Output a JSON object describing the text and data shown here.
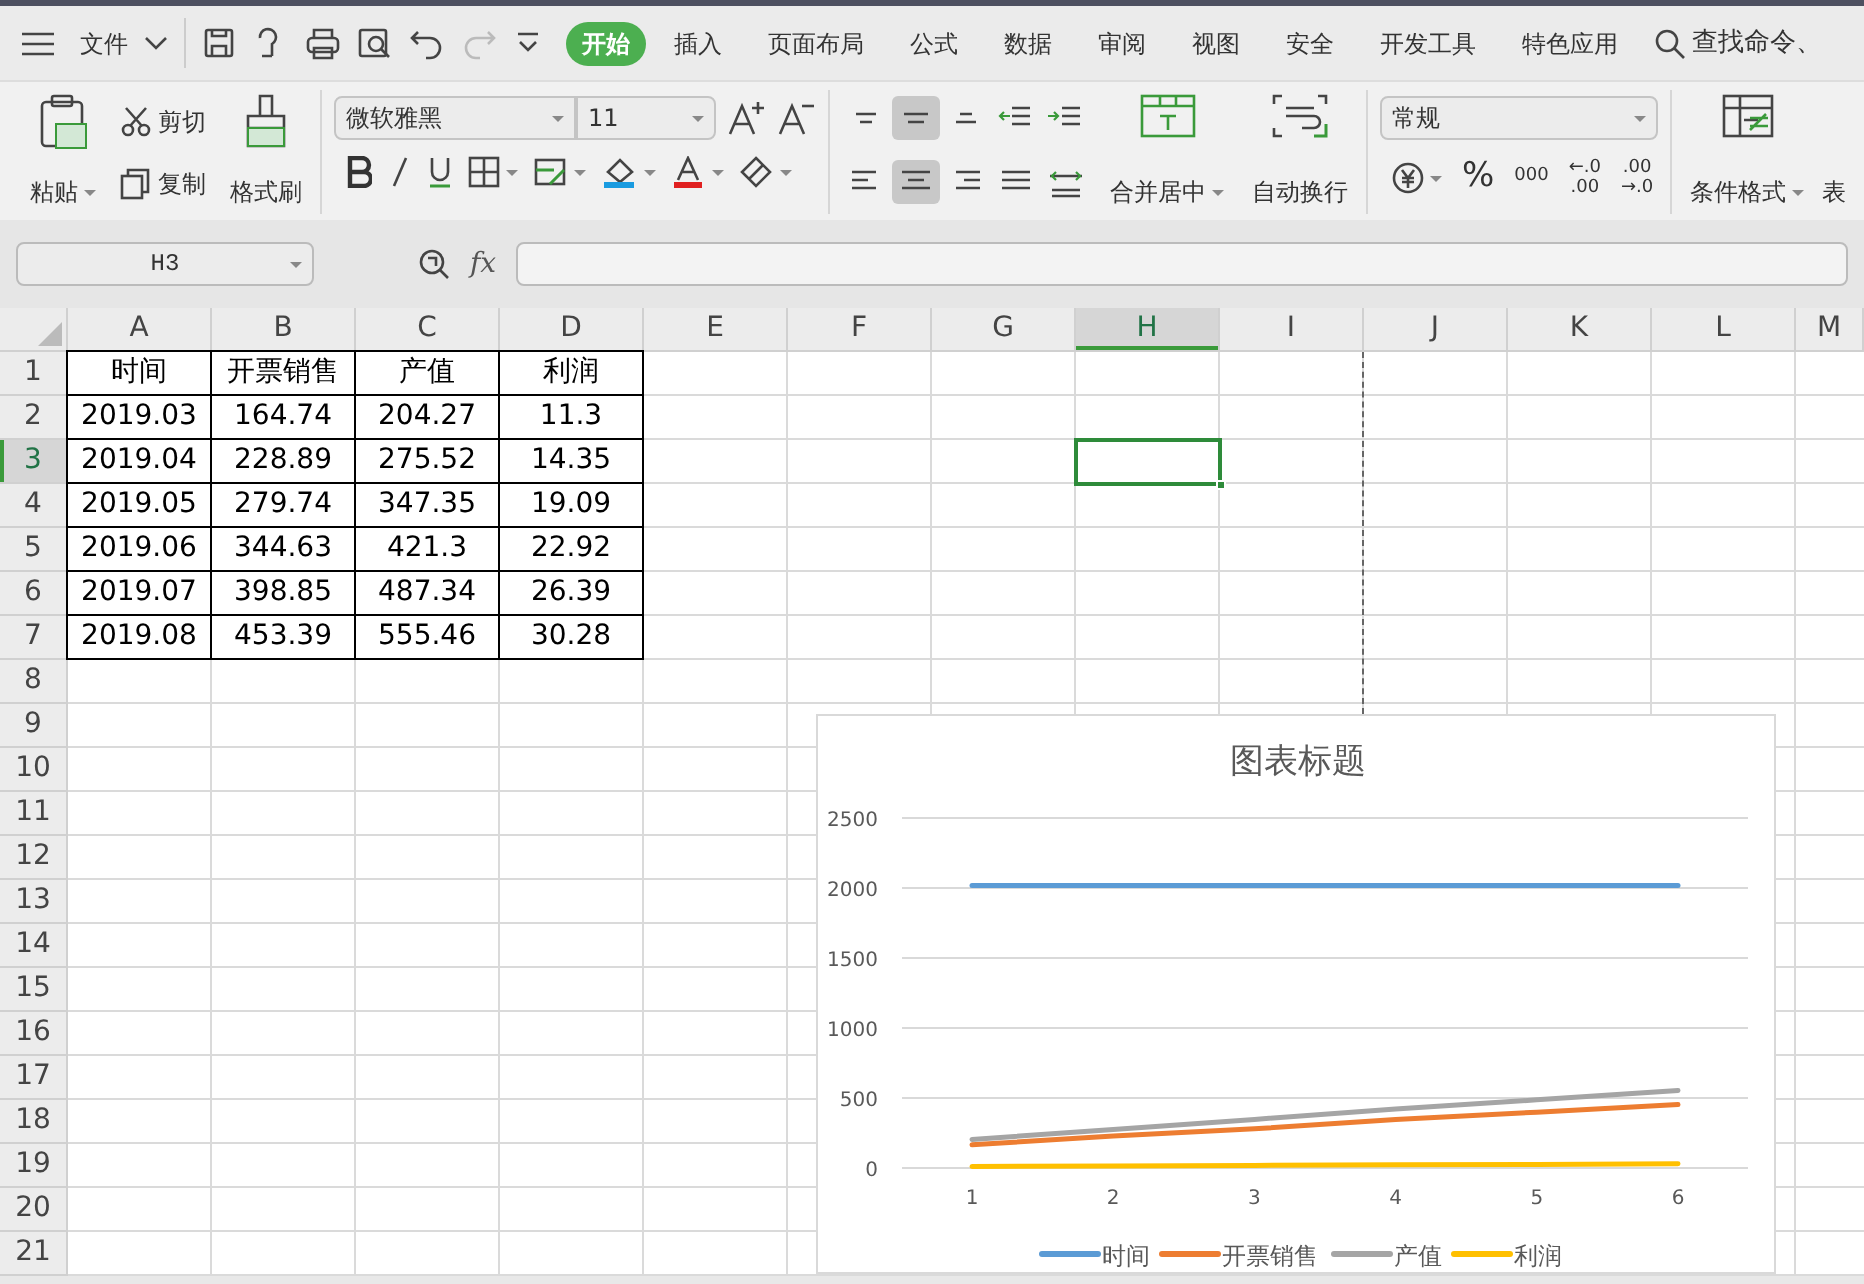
{
  "menu_bar": {
    "file_label": "文件",
    "tabs": [
      {
        "label": "开始",
        "selected": true
      },
      {
        "label": "插入",
        "selected": false
      },
      {
        "label": "页面布局",
        "selected": false
      },
      {
        "label": "公式",
        "selected": false
      },
      {
        "label": "数据",
        "selected": false
      },
      {
        "label": "审阅",
        "selected": false
      },
      {
        "label": "视图",
        "selected": false
      },
      {
        "label": "安全",
        "selected": false
      },
      {
        "label": "开发工具",
        "selected": false
      },
      {
        "label": "特色应用",
        "selected": false
      }
    ],
    "search": "查找命令、"
  },
  "ribbon": {
    "paste": "粘贴",
    "cut": "剪切",
    "copy": "复制",
    "format_painter": "格式刷",
    "font_name": "微软雅黑",
    "font_size": "11",
    "alignment": [
      {
        "selected": false
      },
      {
        "selected": true
      },
      {
        "selected": false
      },
      {
        "selected": false
      },
      {
        "selected": false
      },
      {
        "selected": false
      },
      {
        "selected": true
      },
      {
        "selected": false
      },
      {
        "selected": false
      },
      {
        "selected": false
      }
    ],
    "merge": "合并居中",
    "wrap": "自动换行",
    "number_format": "常规",
    "percent": "%",
    "thousands": "000",
    "increase_decimal": [
      "←.0",
      ".00"
    ],
    "decrease_decimal": [
      ".00",
      "→.0"
    ],
    "conditional_format": "条件格式",
    "cut_off_button": "表"
  },
  "formula_bar": {
    "name_box": "H3",
    "fx": "fx"
  },
  "sheet": {
    "columns": [
      {
        "label": "A",
        "selected": false
      },
      {
        "label": "B",
        "selected": false
      },
      {
        "label": "C",
        "selected": false
      },
      {
        "label": "D",
        "selected": false
      },
      {
        "label": "E",
        "selected": false
      },
      {
        "label": "F",
        "selected": false
      },
      {
        "label": "G",
        "selected": false
      },
      {
        "label": "H",
        "selected": true
      },
      {
        "label": "I",
        "selected": false
      },
      {
        "label": "J",
        "selected": false
      },
      {
        "label": "K",
        "selected": false
      },
      {
        "label": "L",
        "selected": false
      },
      {
        "label": "M",
        "selected": false
      }
    ],
    "rows": [
      {
        "label": "1",
        "selected": false,
        "cells": [
          "时间",
          "开票销售",
          "产值",
          "利润"
        ]
      },
      {
        "label": "2",
        "selected": false,
        "cells": [
          "2019.03",
          "164.74",
          "204.27",
          "11.3"
        ]
      },
      {
        "label": "3",
        "selected": true,
        "cells": [
          "2019.04",
          "228.89",
          "275.52",
          "14.35"
        ]
      },
      {
        "label": "4",
        "selected": false,
        "cells": [
          "2019.05",
          "279.74",
          "347.35",
          "19.09"
        ]
      },
      {
        "label": "5",
        "selected": false,
        "cells": [
          "2019.06",
          "344.63",
          "421.3",
          "22.92"
        ]
      },
      {
        "label": "6",
        "selected": false,
        "cells": [
          "2019.07",
          "398.85",
          "487.34",
          "26.39"
        ]
      },
      {
        "label": "7",
        "selected": false,
        "cells": [
          "2019.08",
          "453.39",
          "555.46",
          "30.28"
        ]
      },
      {
        "label": "8",
        "selected": false
      },
      {
        "label": "9",
        "selected": false
      },
      {
        "label": "10",
        "selected": false
      },
      {
        "label": "11",
        "selected": false
      },
      {
        "label": "12",
        "selected": false
      },
      {
        "label": "13",
        "selected": false
      },
      {
        "label": "14",
        "selected": false
      },
      {
        "label": "15",
        "selected": false
      },
      {
        "label": "16",
        "selected": false
      },
      {
        "label": "17",
        "selected": false
      },
      {
        "label": "18",
        "selected": false
      },
      {
        "label": "19",
        "selected": false
      },
      {
        "label": "20",
        "selected": false
      },
      {
        "label": "21",
        "selected": false
      }
    ]
  },
  "chart": {
    "chart_data": {
      "type": "line",
      "title": "图表标题",
      "categories": [
        "1",
        "2",
        "3",
        "4",
        "5",
        "6"
      ],
      "series": [
        {
          "name": "时间",
          "color": "#5b9bd5",
          "values": [
            2019,
            2019,
            2019,
            2019,
            2019,
            2019
          ]
        },
        {
          "name": "开票销售",
          "color": "#ed7d31",
          "values": [
            165,
            229,
            280,
            345,
            399,
            453
          ]
        },
        {
          "name": "产值",
          "color": "#a5a5a5",
          "values": [
            204,
            276,
            347,
            421,
            487,
            555
          ]
        },
        {
          "name": "利润",
          "color": "#ffc000",
          "values": [
            11,
            14,
            19,
            23,
            26,
            30
          ]
        }
      ],
      "ylim": [
        0,
        2500
      ],
      "yticks": [
        0,
        500,
        1000,
        1500,
        2000,
        2500
      ],
      "grid": true,
      "legend": true
    }
  }
}
